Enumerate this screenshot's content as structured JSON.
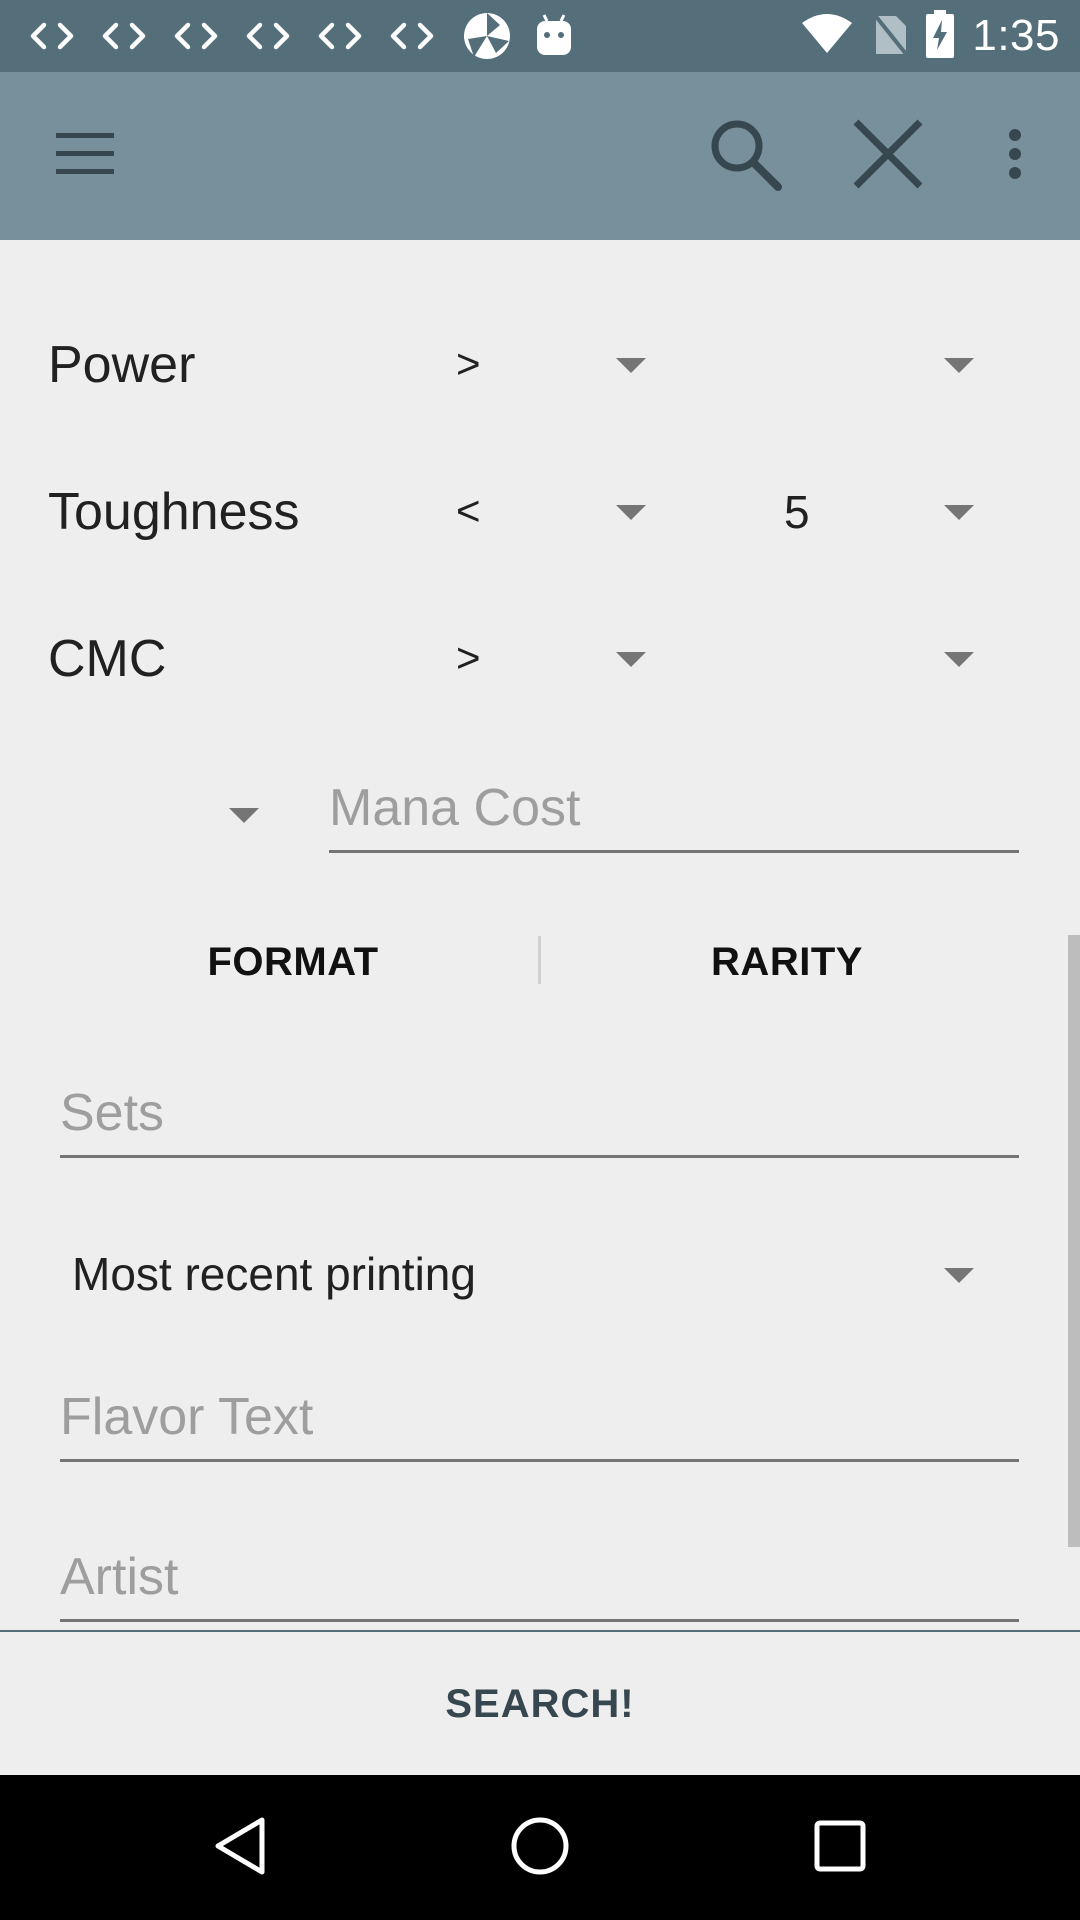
{
  "status_bar": {
    "time": "1:35",
    "left_icons": [
      "code-icon",
      "code-icon",
      "code-icon",
      "code-icon",
      "code-icon",
      "code-icon",
      "pinwheel-icon",
      "android-icon"
    ],
    "right_icons": [
      "wifi-icon",
      "no-sim-icon",
      "battery-charging-icon"
    ]
  },
  "toolbar": {
    "menu_icon": "menu-icon",
    "search_icon": "search-icon",
    "close_icon": "close-icon",
    "overflow_icon": "more-vert-icon"
  },
  "form": {
    "power": {
      "label": "Power",
      "operator": ">",
      "value": ""
    },
    "toughness": {
      "label": "Toughness",
      "operator": "<",
      "value": "5"
    },
    "cmc": {
      "label": "CMC",
      "operator": ">",
      "value": ""
    },
    "mana_cost": {
      "placeholder": "Mana Cost"
    },
    "tabs": {
      "format": "FORMAT",
      "rarity": "RARITY"
    },
    "sets": {
      "placeholder": "Sets"
    },
    "printing": {
      "selected": "Most recent printing"
    },
    "flavor_text": {
      "placeholder": "Flavor Text"
    },
    "artist": {
      "placeholder": "Artist"
    }
  },
  "search_button": "SEARCH!",
  "nav_bar": {
    "back_icon": "back-icon",
    "home_icon": "home-icon",
    "recents_icon": "recents-icon"
  },
  "colors": {
    "status_bar": "#546e7a",
    "toolbar": "#78909c",
    "background": "#eeeeee"
  }
}
